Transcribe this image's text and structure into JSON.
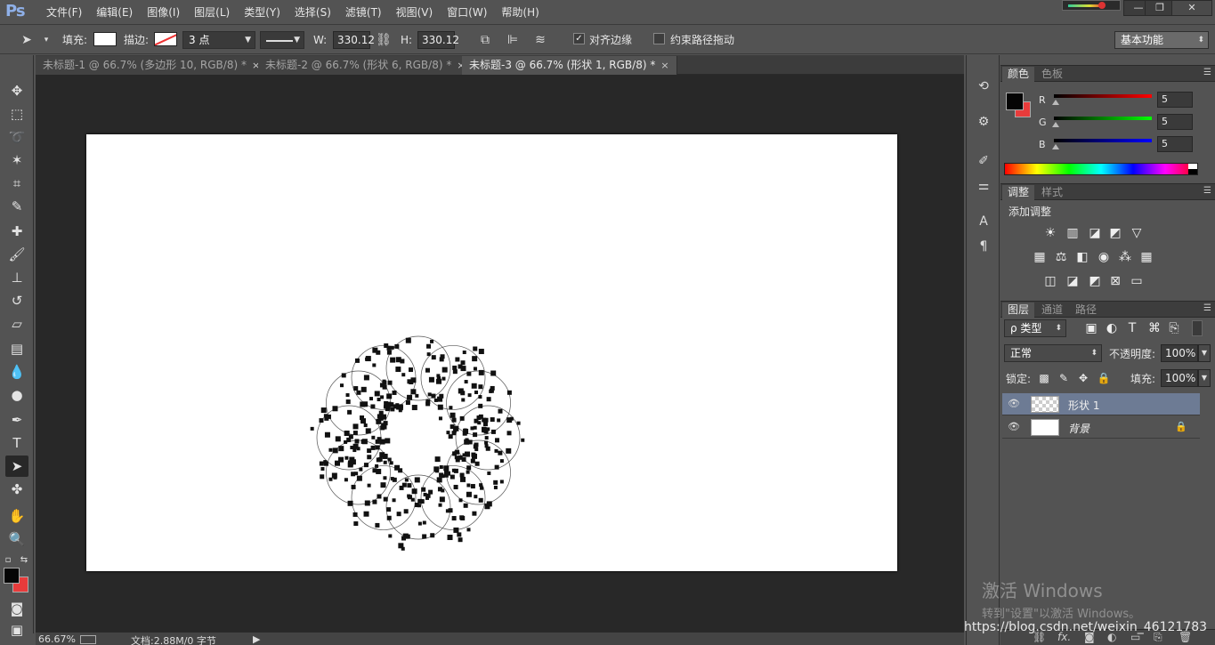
{
  "app": {
    "logo": "Ps"
  },
  "menu": [
    "文件(F)",
    "编辑(E)",
    "图像(I)",
    "图层(L)",
    "类型(Y)",
    "选择(S)",
    "滤镜(T)",
    "视图(V)",
    "窗口(W)",
    "帮助(H)"
  ],
  "window_controls": {
    "minimize": "—",
    "restore": "❐",
    "close": "✕"
  },
  "options": {
    "fill_label": "填充:",
    "stroke_label": "描边:",
    "stroke_width": "3 点",
    "w_label": "W:",
    "w_value": "330.12",
    "h_label": "H:",
    "h_value": "330.12",
    "align_edges_label": "对齐边缘",
    "align_edges_checked": true,
    "constrain_path_label": "约束路径拖动",
    "constrain_path_checked": false,
    "workspace": "基本功能"
  },
  "tabs": [
    {
      "label": "未标题-1 @ 66.7% (多边形 10, RGB/8) *",
      "active": false
    },
    {
      "label": "未标题-2 @ 66.7% (形状 6, RGB/8) *",
      "active": false
    },
    {
      "label": "未标题-3 @ 66.7% (形状 1, RGB/8) *",
      "active": true
    }
  ],
  "tab_close": "×",
  "status": {
    "zoom": "66.67%",
    "doc": "文档:2.88M/0 字节"
  },
  "color_panel": {
    "tabs": [
      "颜色",
      "色板"
    ],
    "channels": [
      {
        "label": "R",
        "value": "5",
        "color": "#e03030"
      },
      {
        "label": "G",
        "value": "5",
        "color": "#30c030"
      },
      {
        "label": "B",
        "value": "5",
        "color": "#3040e0"
      }
    ]
  },
  "adjust_panel": {
    "tabs": [
      "调整",
      "样式"
    ],
    "title": "添加调整"
  },
  "layers_panel": {
    "tabs": [
      "图层",
      "通道",
      "路径"
    ],
    "filter_kind": "ρ 类型",
    "blend_mode": "正常",
    "opacity_label": "不透明度:",
    "opacity_value": "100%",
    "lock_label": "锁定:",
    "fill_label": "填充:",
    "fill_value": "100%",
    "layers": [
      {
        "name": "形状 1",
        "selected": true
      },
      {
        "name": "背景",
        "selected": false
      }
    ]
  },
  "watermark": {
    "line1": "激活 Windows",
    "line2": "转到\"设置\"以激活 Windows。",
    "url": "https://blog.csdn.net/weixin_46121783"
  },
  "colors": {
    "foreground": "#050505",
    "background": "#e83b3b",
    "selected_layer": "#6d7b94"
  }
}
